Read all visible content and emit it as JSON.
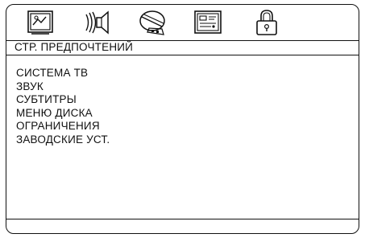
{
  "tabs": [
    {
      "id": "general",
      "icon": "monitor-settings-icon"
    },
    {
      "id": "audio",
      "icon": "speaker-sound-icon"
    },
    {
      "id": "video",
      "icon": "disc-film-icon"
    },
    {
      "id": "preferences",
      "icon": "preference-panel-icon"
    },
    {
      "id": "password",
      "icon": "padlock-icon"
    }
  ],
  "page": {
    "title": "СТР. ПРЕДПОЧТЕНИЙ"
  },
  "menu": {
    "items": [
      "СИСТЕМА ТВ",
      "ЗВУК",
      "СУБТИТРЫ",
      "МЕНЮ ДИСКА",
      "ОГРАНИЧЕНИЯ",
      "ЗАВОДСКИЕ УСТ."
    ]
  }
}
